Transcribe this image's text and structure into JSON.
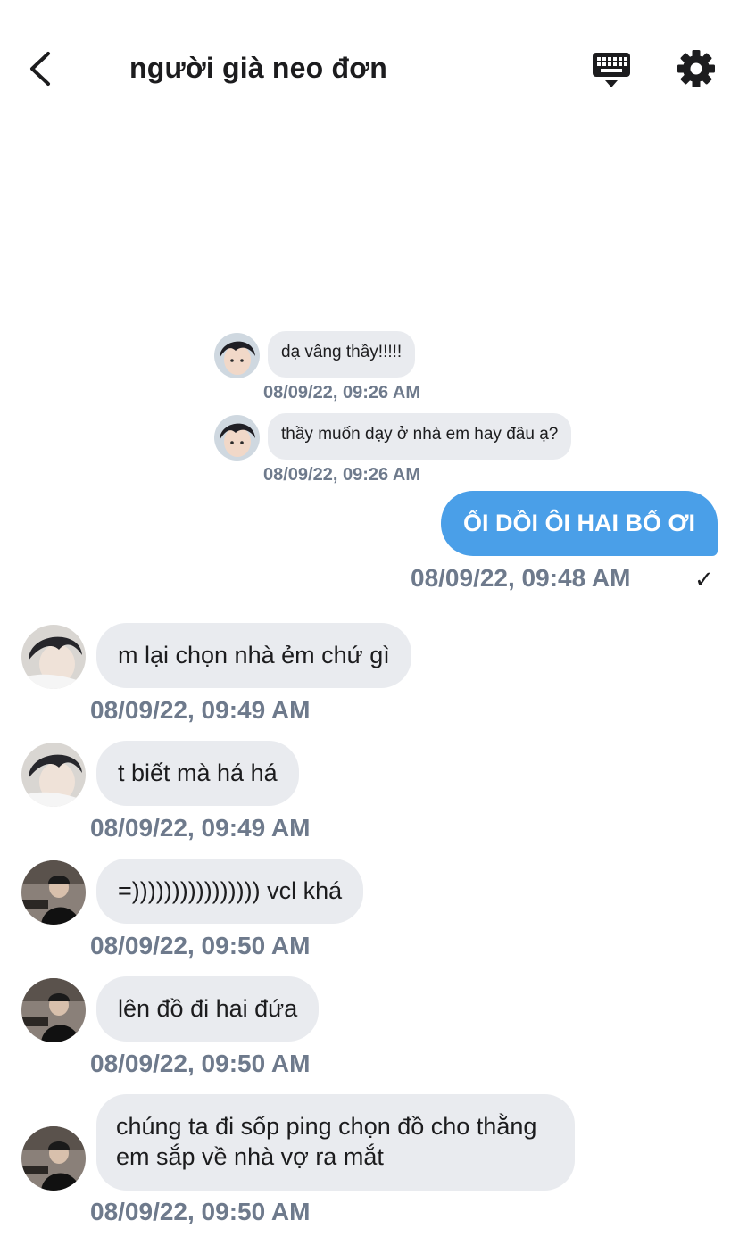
{
  "header": {
    "title": "người già neo đơn",
    "back_icon": "chevron-left-icon",
    "keyboard_icon": "keyboard-icon",
    "settings_icon": "gear-icon"
  },
  "messages_small": [
    {
      "text": "dạ vâng thầy!!!!!",
      "time": "08/09/22, 09:26 AM"
    },
    {
      "text": "thầy muốn dạy ở nhà em hay đâu ạ?",
      "time": "08/09/22, 09:26 AM"
    }
  ],
  "sent_message": {
    "text": "ỐI DỒI ÔI HAI BỐ ƠI",
    "time": "08/09/22, 09:48 AM",
    "status": "✓"
  },
  "messages_big": [
    {
      "text": "m lại chọn nhà ẻm chứ gì",
      "time": "08/09/22, 09:49 AM"
    },
    {
      "text": "t biết mà há há",
      "time": "08/09/22, 09:49 AM"
    },
    {
      "text": "=)))))))))))))))) vcl khá",
      "time": "08/09/22, 09:50 AM"
    },
    {
      "text": "lên đồ đi hai đứa",
      "time": "08/09/22, 09:50 AM"
    },
    {
      "text": "chúng ta đi sốp ping chọn đồ cho thằng em sắp về nhà vợ ra mắt",
      "time": "08/09/22, 09:50 AM"
    }
  ],
  "colors": {
    "sent_bubble": "#4a9fe8",
    "received_bubble": "#e9ebef",
    "timestamp": "#6e7a8c"
  }
}
